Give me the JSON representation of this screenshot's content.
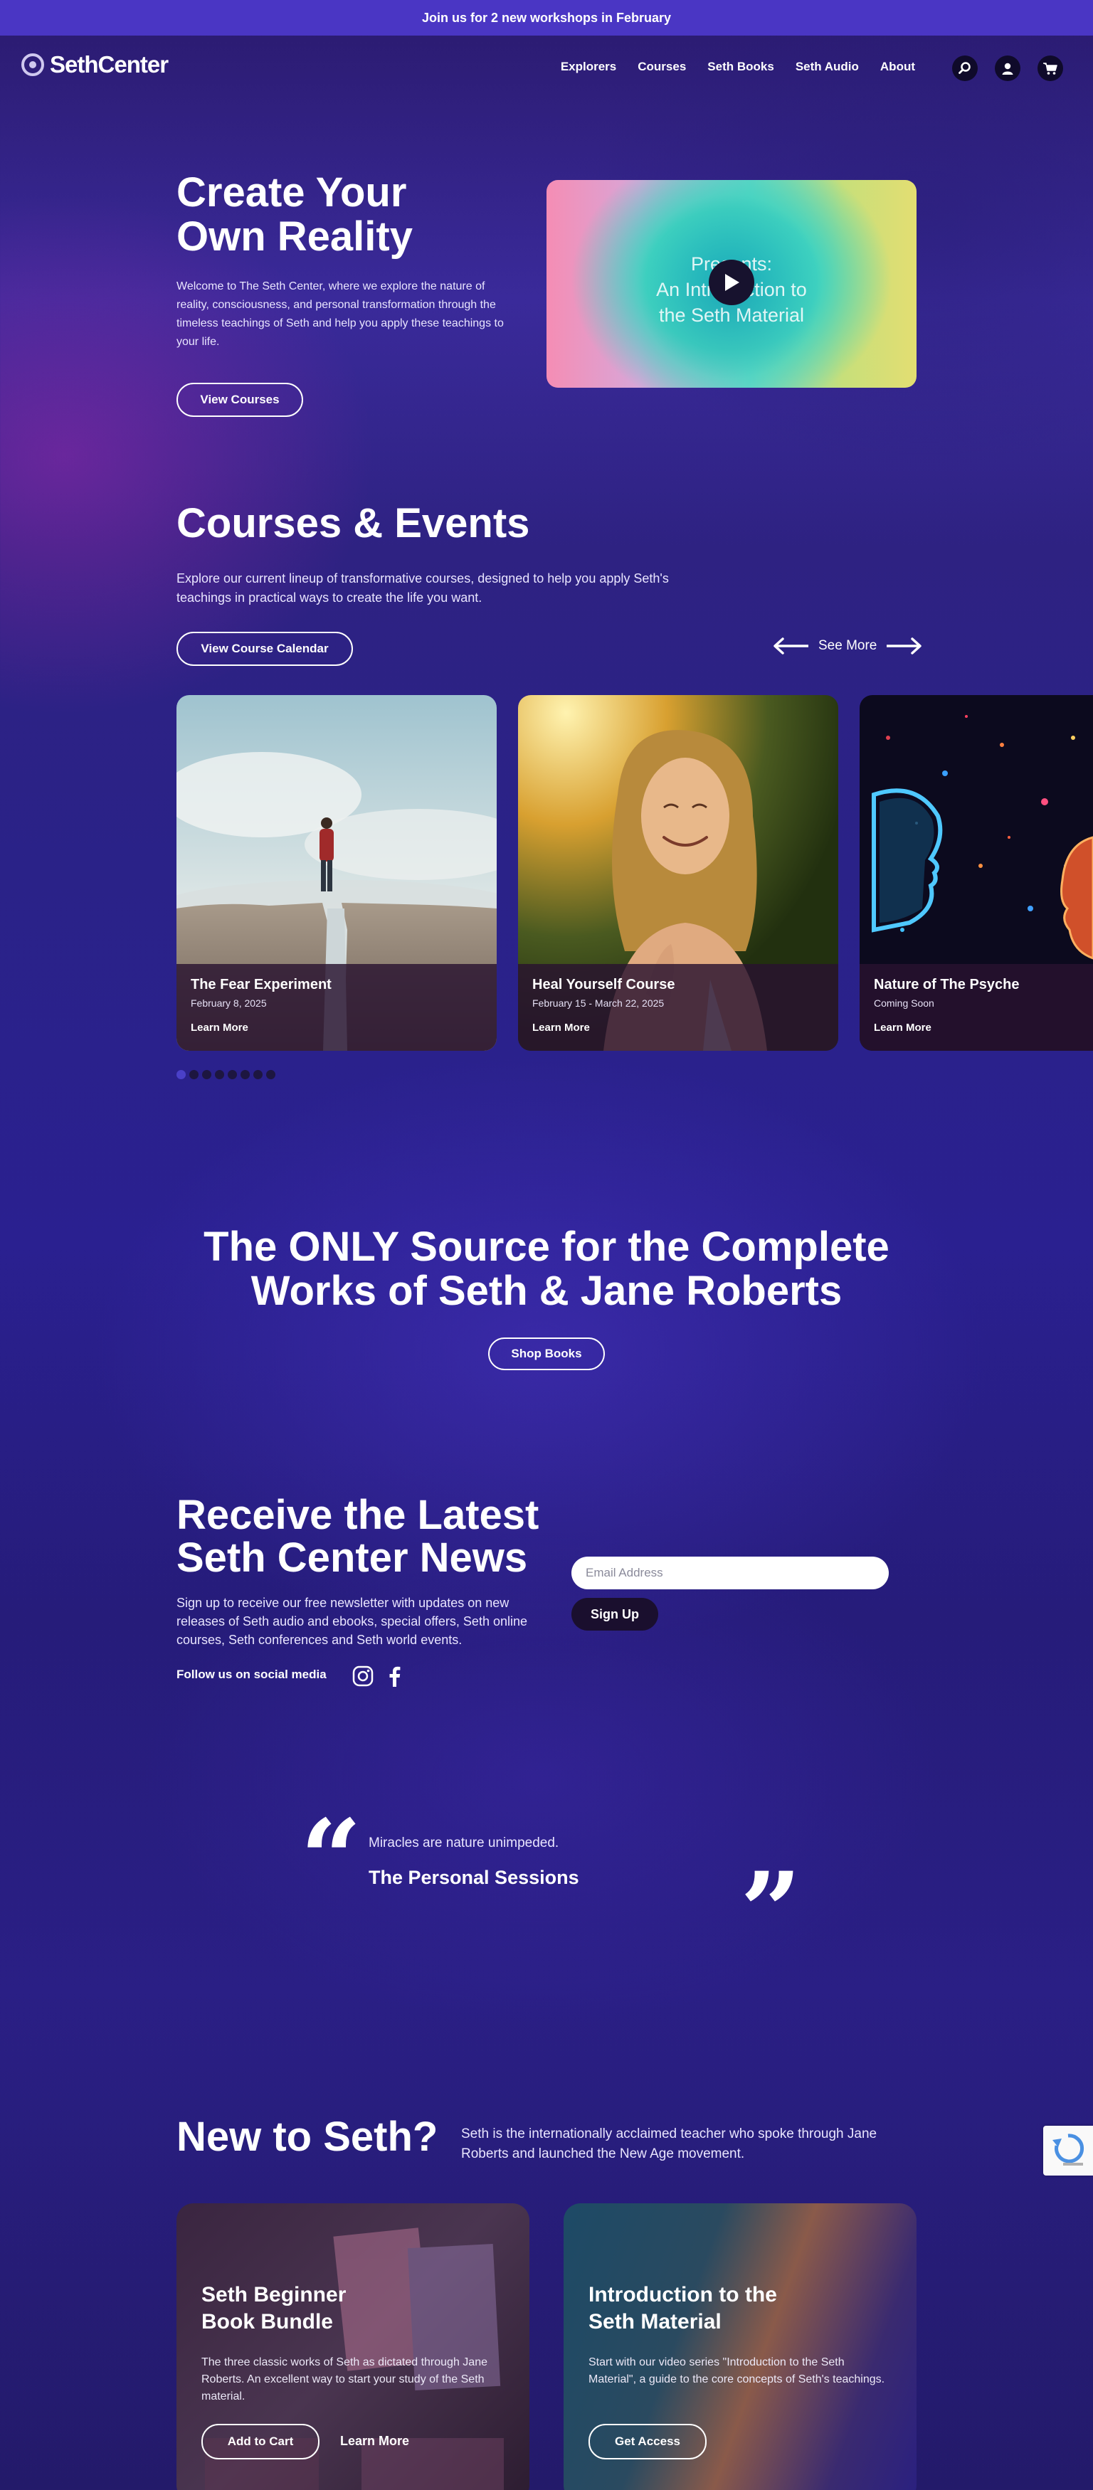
{
  "announcement": "Join us for 2 new workshops in February",
  "brand": {
    "name": "SethCenter"
  },
  "nav": [
    "Explorers",
    "Courses",
    "Seth Books",
    "Seth Audio",
    "About"
  ],
  "header_icons": [
    "search-icon",
    "user-icon",
    "cart-icon"
  ],
  "hero": {
    "title_line1": "Create Your",
    "title_line2": "Own Reality",
    "text": "Welcome to The Seth Center, where we explore the nature of reality, consciousness, and personal transformation through the timeless teachings of Seth and help you apply these teachings to your life.",
    "button": "View Courses",
    "video": {
      "line1": "Presents:",
      "line2": "An Introduction to",
      "line3": "the Seth Material"
    }
  },
  "courses": {
    "title": "Courses & Events",
    "text": "Explore our current lineup of transformative courses, designed to help you apply Seth's teachings in practical ways to create the life you want.",
    "button": "View Course Calendar",
    "see_more": "See More",
    "cards": [
      {
        "title": "The Fear Experiment",
        "date": "February 8, 2025",
        "link": "Learn More"
      },
      {
        "title": "Heal Yourself Course",
        "date": "February 15 - March 22, 2025",
        "link": "Learn More"
      },
      {
        "title": "Nature of The Psyche",
        "date": "Coming Soon",
        "link": "Learn More"
      }
    ],
    "carousel_pages": 8,
    "carousel_active": 1
  },
  "books": {
    "title_line1": "The ONLY Source for the Complete",
    "title_line2": "Works of Seth & Jane Roberts",
    "button": "Shop Books"
  },
  "newsletter": {
    "title_line1": "Receive the Latest",
    "title_line2": "Seth Center News",
    "text": "Sign up to receive our free newsletter with updates on new releases of Seth audio and ebooks, special offers, Seth online courses, Seth conferences and Seth world events.",
    "follow": "Follow us on social media",
    "email_placeholder": "Email Address",
    "signup": "Sign Up"
  },
  "quote": {
    "text": "Miracles are nature unimpeded.",
    "source": "The Personal Sessions"
  },
  "new_to_seth": {
    "title": "New to Seth?",
    "text": "Seth is the internationally acclaimed teacher who spoke through Jane Roberts and launched the New Age movement.",
    "promos": [
      {
        "title_line1": "Seth Beginner",
        "title_line2": "Book Bundle",
        "text": "The three classic works of Seth as dictated through Jane Roberts. An excellent way to start your study of the Seth material.",
        "button": "Add to Cart",
        "link": "Learn More"
      },
      {
        "title_line1": "Introduction to the",
        "title_line2": "Seth Material",
        "text": "Start with our video series \"Introduction to the Seth Material\", a guide to the core concepts of Seth's teachings.",
        "button": "Get Access"
      }
    ]
  },
  "colors": {
    "accent": "#4a36c4",
    "dark_button": "#1a0f2e"
  }
}
